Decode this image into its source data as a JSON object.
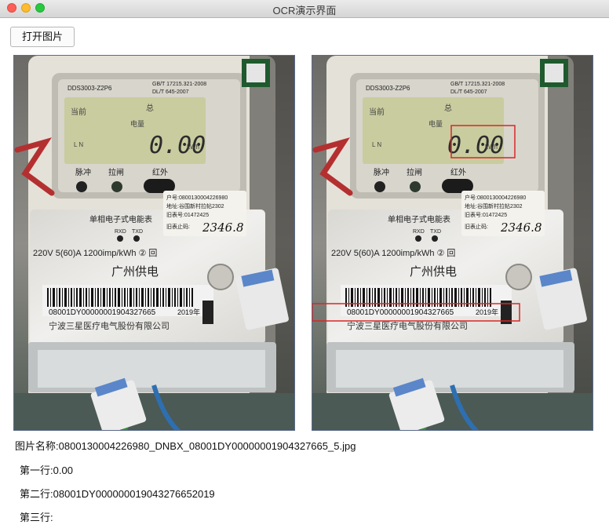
{
  "window": {
    "title": "OCR演示界面"
  },
  "toolbar": {
    "open_label": "打开图片"
  },
  "meter": {
    "model_text": "DDS3003-Z2P6",
    "standard_line1": "GB/T 17215.321-2008",
    "standard_line2": "DL/T 645-2007",
    "lcd_current": "当前",
    "lcd_total": "总",
    "lcd_energy": "电量",
    "lcd_ln": "L N",
    "lcd_value": "0.00",
    "lcd_unit": "kWh",
    "label_pulse": "脉冲",
    "label_switch": "拉闸",
    "label_ir": "红外",
    "nameplate_type": "单相电子式电能表",
    "nameplate_rxd": "RXD",
    "nameplate_txd": "TXD",
    "spec_line": "220V 5(60)A 1200imp/kWh ② 回",
    "utility": "广州供电",
    "barcode_text": "08001DY00000001904327665",
    "barcode_year": "2019年",
    "manufacturer": "宁波三星医疗电气股份有限公司",
    "sticker_line1": "户号:0800130004226980",
    "sticker_line2": "地址:谷围新村拉帖2302",
    "sticker_line3": "旧表号:01472425",
    "sticker_line4": "旧表止码:",
    "sticker_reading": "2346.8"
  },
  "result": {
    "filename_label": "图片名称:",
    "filename_value": "0800130004226980_DNBX_08001DY00000001904327665_5.jpg",
    "row1_label": "第一行:",
    "row1_value": "0.00",
    "row2_label": "第二行:",
    "row2_value": "08001DY000000019043276652019",
    "row3_label": "第三行:",
    "row3_value": ""
  },
  "colors": {
    "detection_box": "#d92626",
    "lcd_background": "#c9cc9f",
    "meter_body": "#e4e1d8"
  }
}
